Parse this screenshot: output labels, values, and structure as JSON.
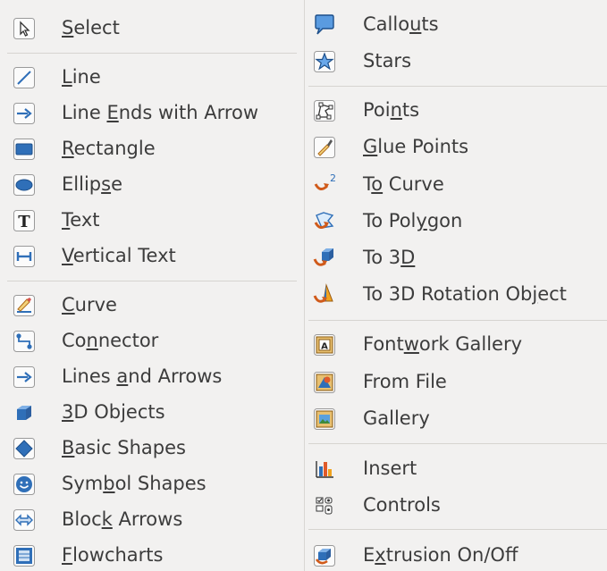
{
  "left_menu": [
    {
      "pre": "",
      "u": "S",
      "post": "elect",
      "icon": "select-pointer-icon"
    },
    {
      "pre": "",
      "u": "L",
      "post": "ine",
      "icon": "line-icon"
    },
    {
      "pre": "Line ",
      "u": "E",
      "post": "nds with Arrow",
      "icon": "line-ends-arrow-icon"
    },
    {
      "pre": "",
      "u": "R",
      "post": "ectangle",
      "icon": "rectangle-icon"
    },
    {
      "pre": "Ellip",
      "u": "s",
      "post": "e",
      "icon": "ellipse-icon"
    },
    {
      "pre": "",
      "u": "T",
      "post": "ext",
      "icon": "text-icon"
    },
    {
      "pre": "",
      "u": "V",
      "post": "ertical Text",
      "icon": "vertical-text-icon"
    },
    {
      "pre": "",
      "u": "C",
      "post": "urve",
      "icon": "curve-icon"
    },
    {
      "pre": "Co",
      "u": "n",
      "post": "nector",
      "icon": "connector-icon"
    },
    {
      "pre": "Lines ",
      "u": "a",
      "post": "nd Arrows",
      "icon": "lines-arrows-icon"
    },
    {
      "pre": "",
      "u": "3",
      "post": "D Objects",
      "icon": "3d-objects-icon"
    },
    {
      "pre": "",
      "u": "B",
      "post": "asic Shapes",
      "icon": "basic-shapes-icon"
    },
    {
      "pre": "Sym",
      "u": "b",
      "post": "ol Shapes",
      "icon": "symbol-shapes-icon"
    },
    {
      "pre": "Bloc",
      "u": "k",
      "post": " Arrows",
      "icon": "block-arrows-icon"
    },
    {
      "pre": "",
      "u": "F",
      "post": "lowcharts",
      "icon": "flowcharts-icon"
    }
  ],
  "right_menu": [
    {
      "pre": "Callo",
      "u": "u",
      "post": "ts",
      "icon": "callouts-icon"
    },
    {
      "pre": "Stars",
      "u": "",
      "post": "",
      "icon": "stars-icon"
    },
    {
      "pre": "Poi",
      "u": "n",
      "post": "ts",
      "icon": "points-icon"
    },
    {
      "pre": "",
      "u": "G",
      "post": "lue Points",
      "icon": "glue-points-icon"
    },
    {
      "pre": "T",
      "u": "o",
      "post": " Curve",
      "icon": "to-curve-icon"
    },
    {
      "pre": "To Pol",
      "u": "y",
      "post": "gon",
      "icon": "to-polygon-icon"
    },
    {
      "pre": "To 3",
      "u": "D",
      "post": "",
      "icon": "to-3d-icon"
    },
    {
      "pre": "To 3D Rotation Ob",
      "u": "j",
      "post": "ect",
      "icon": "to-3d-rotation-icon"
    },
    {
      "pre": "Font",
      "u": "w",
      "post": "ork Gallery",
      "icon": "fontwork-gallery-icon"
    },
    {
      "pre": "From File",
      "u": "",
      "post": "",
      "icon": "from-file-icon"
    },
    {
      "pre": "Gallery",
      "u": "",
      "post": "",
      "icon": "gallery-icon"
    },
    {
      "pre": "Insert",
      "u": "",
      "post": "",
      "icon": "insert-icon"
    },
    {
      "pre": "Controls",
      "u": "",
      "post": "",
      "icon": "controls-icon"
    },
    {
      "pre": "E",
      "u": "x",
      "post": "trusion On/Off",
      "icon": "extrusion-toggle-icon"
    }
  ],
  "colors": {
    "menu_bg": "#f2f1f0",
    "separator": "#d6d4d0",
    "text": "#3c3c3c",
    "icon_blue": "#2f6fb8"
  }
}
